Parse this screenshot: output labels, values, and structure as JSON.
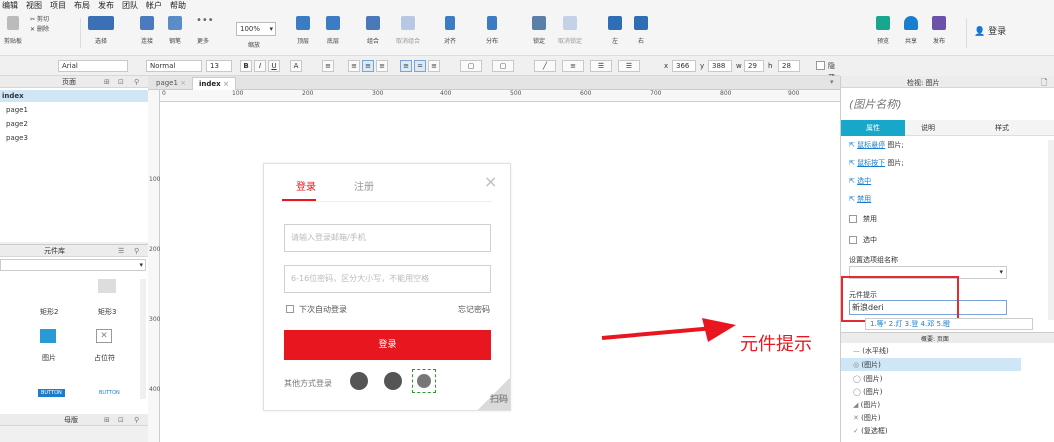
{
  "menu": [
    "编辑",
    "视图",
    "项目",
    "布局",
    "发布",
    "团队",
    "帐户",
    "帮助"
  ],
  "toolbar": {
    "clipboard": {
      "cut": "剪切",
      "copy_del": "删除",
      "label": "剪贴板"
    },
    "select_label": "选择",
    "connect_label": "连接",
    "pen_label": "钢笔",
    "more_label": "更多",
    "zoom_value": "100%",
    "zoom_label": "缩放",
    "top_label": "顶层",
    "bottom_label": "底层",
    "group_label": "组合",
    "ungroup_label": "取消组合",
    "align_label": "对齐",
    "distribute_label": "分布",
    "lock_label": "锁定",
    "unlock_label": "取消锁定",
    "left_label": "左",
    "right_label": "右",
    "preview_label": "预览",
    "share_label": "共享",
    "publish_label": "发布",
    "login_label": "登录"
  },
  "format": {
    "font": "Arial",
    "style": "Normal",
    "size": "13",
    "x_label": "x",
    "x_value": "366",
    "y_label": "y",
    "y_value": "388",
    "w_label": "w",
    "w_value": "29",
    "h_label": "h",
    "h_value": "28",
    "hide_label": "隐藏"
  },
  "pages_panel": {
    "title": "页面",
    "items": [
      "index",
      "page1",
      "page2",
      "page3"
    ]
  },
  "widgets_panel": {
    "title": "元件库",
    "items": [
      "矩形2",
      "矩形3",
      "图片",
      "占位符"
    ],
    "button_labels": [
      "BUTTON",
      "BUTTON"
    ]
  },
  "masters_panel": {
    "title": "母版"
  },
  "tabs": [
    "page1",
    "index"
  ],
  "ruler": [
    "0",
    "100",
    "200",
    "300",
    "400",
    "500",
    "600",
    "700",
    "800",
    "900"
  ],
  "ruler_v": [
    "100",
    "200",
    "300",
    "400"
  ],
  "login_card": {
    "tab_login": "登录",
    "tab_register": "注册",
    "email_placeholder": "请输入登录邮箱/手机",
    "password_placeholder": "6-16位密码，区分大小写，不能用空格",
    "remember": "下次自动登录",
    "forgot": "忘记密码",
    "submit": "登录",
    "other": "其他方式登录",
    "scan": "扫码"
  },
  "inspector": {
    "header": "检视: 图片",
    "name_placeholder": "(图片名称)",
    "tabs": [
      "属性",
      "说明",
      "样式"
    ],
    "interactions": [
      "鼠标悬停",
      "鼠标按下",
      "选中",
      "禁用"
    ],
    "interaction_suffix": [
      "图片;",
      "图片;"
    ],
    "disabled": "禁用",
    "selected": "选中",
    "group_name_label": "设置选项组名称",
    "tooltip_label": "元件提示",
    "tooltip_value": "新浪deri",
    "ime_candidates": "1.等ᵅ 2.灯 3.登 4.邓 5.瞪",
    "outline_header": "概要: 页面",
    "outline_items": [
      "(水平线)",
      "(图片)",
      "(图片)",
      "(图片)",
      "(图片)",
      "(图片)",
      "(复选框)"
    ]
  },
  "annotation": "元件提示",
  "colors": {
    "accent_red": "#e8171f",
    "blue": "#1a7ed0",
    "teal": "#16a7c9",
    "highlight_box": "#e32b35"
  }
}
